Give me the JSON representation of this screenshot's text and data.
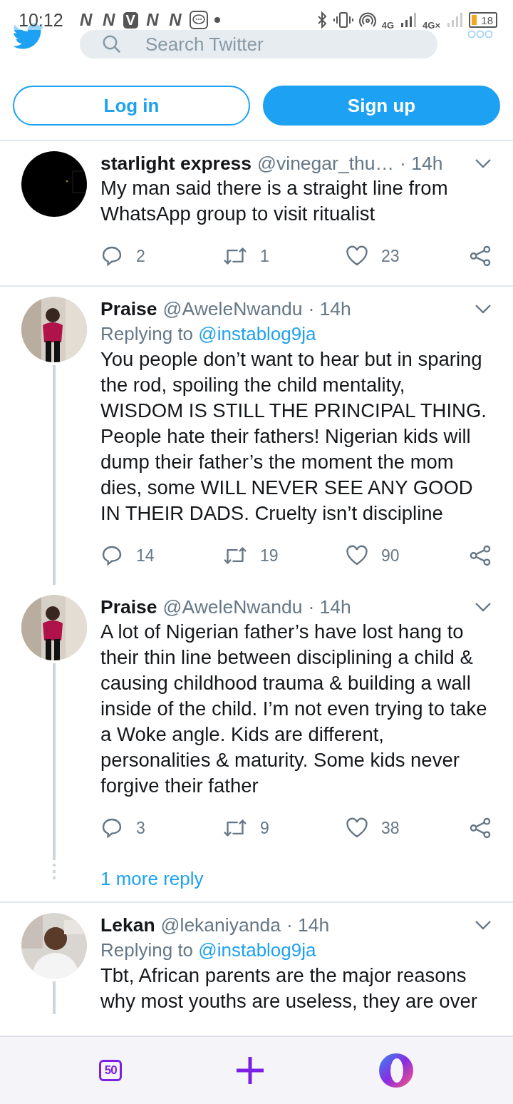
{
  "status_bar": {
    "time": "10:12",
    "notification_icons": [
      "N",
      "N",
      "V",
      "N",
      "N"
    ],
    "network": [
      "4G",
      "4G×"
    ],
    "battery": "18"
  },
  "search": {
    "placeholder": "Search Twitter"
  },
  "auth_buttons": {
    "login": "Log in",
    "signup": "Sign up"
  },
  "timeline": [
    {
      "kind": "tweet",
      "name": "starlight express",
      "handle": "@vinegar_thu…",
      "time": "· 14h",
      "text": "My man said there is a straight line from WhatsApp group to visit ritualist",
      "replies": "2",
      "retweets": "1",
      "likes": "23",
      "thread_below": false
    },
    {
      "kind": "tweet",
      "name": "Praise",
      "handle": "@AweleNwandu",
      "time": "· 14h",
      "replying_label": "Replying to",
      "replying_to": "@instablog9ja",
      "text": "You people don’t want to hear but in sparing the rod, spoiling the child mentality, WISDOM IS STILL THE PRINCIPAL THING. People hate their fathers! Nigerian kids will dump their father’s the moment the mom dies, some WILL NEVER SEE ANY GOOD IN THEIR DADS. Cruelty isn’t discipline",
      "replies": "14",
      "retweets": "19",
      "likes": "90",
      "thread_below": true
    },
    {
      "kind": "tweet",
      "name": "Praise",
      "handle": "@AweleNwandu",
      "time": "· 14h",
      "text": "A lot of Nigerian father’s have lost hang to their thin line between disciplining a child & causing childhood trauma & building a wall inside of the child. I’m not even trying to take a Woke angle. Kids are different, personalities & maturity. Some kids never forgive their father",
      "replies": "3",
      "retweets": "9",
      "likes": "38",
      "thread_below": true
    },
    {
      "kind": "more",
      "label": "1 more reply"
    },
    {
      "kind": "tweet",
      "name": "Lekan",
      "handle": "@lekaniyanda",
      "time": "· 14h",
      "replying_label": "Replying to",
      "replying_to": "@instablog9ja",
      "text": "Tbt, African parents are the major reasons why most youths are useless, they are over",
      "thread_below": true
    }
  ],
  "bottom_bar": {
    "tab_count": "50"
  }
}
